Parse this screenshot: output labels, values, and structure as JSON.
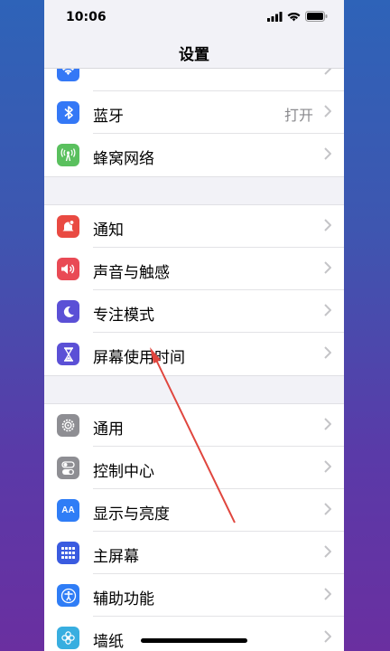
{
  "status_bar": {
    "time": "10:06"
  },
  "nav": {
    "title": "设置"
  },
  "colors": {
    "wifi": "#3478f6",
    "bluetooth": "#3478f6",
    "cellular": "#5ac05e",
    "notifications": "#e94a42",
    "sounds": "#e94a55",
    "focus": "#5b50d6",
    "screen_time": "#5b50d6",
    "general": "#8e8e93",
    "control_center": "#8e8e93",
    "display": "#2f7df6",
    "home_screen": "#3a5be0",
    "accessibility": "#2f7df6",
    "wallpaper": "#38aee0",
    "annotation_arrow": "#e0463e"
  },
  "groups": [
    {
      "items": [
        {
          "id": "wifi",
          "label": "",
          "value": "",
          "icon": "wifi-icon"
        },
        {
          "id": "bluetooth",
          "label": "蓝牙",
          "value": "打开",
          "icon": "bluetooth-icon"
        },
        {
          "id": "cellular",
          "label": "蜂窝网络",
          "value": "",
          "icon": "cellular-icon"
        }
      ]
    },
    {
      "items": [
        {
          "id": "notifications",
          "label": "通知",
          "value": "",
          "icon": "bell-icon"
        },
        {
          "id": "sounds",
          "label": "声音与触感",
          "value": "",
          "icon": "speaker-icon"
        },
        {
          "id": "focus",
          "label": "专注模式",
          "value": "",
          "icon": "moon-icon"
        },
        {
          "id": "screen_time",
          "label": "屏幕使用时间",
          "value": "",
          "icon": "hourglass-icon"
        }
      ]
    },
    {
      "items": [
        {
          "id": "general",
          "label": "通用",
          "value": "",
          "icon": "gear-icon"
        },
        {
          "id": "control_center",
          "label": "控制中心",
          "value": "",
          "icon": "toggles-icon"
        },
        {
          "id": "display",
          "label": "显示与亮度",
          "value": "",
          "icon": "text-size-icon"
        },
        {
          "id": "home_screen",
          "label": "主屏幕",
          "value": "",
          "icon": "grid-icon"
        },
        {
          "id": "accessibility",
          "label": "辅助功能",
          "value": "",
          "icon": "accessibility-icon"
        },
        {
          "id": "wallpaper",
          "label": "墙纸",
          "value": "",
          "icon": "flower-icon"
        }
      ]
    }
  ],
  "icon_text": {
    "display": "AA"
  }
}
